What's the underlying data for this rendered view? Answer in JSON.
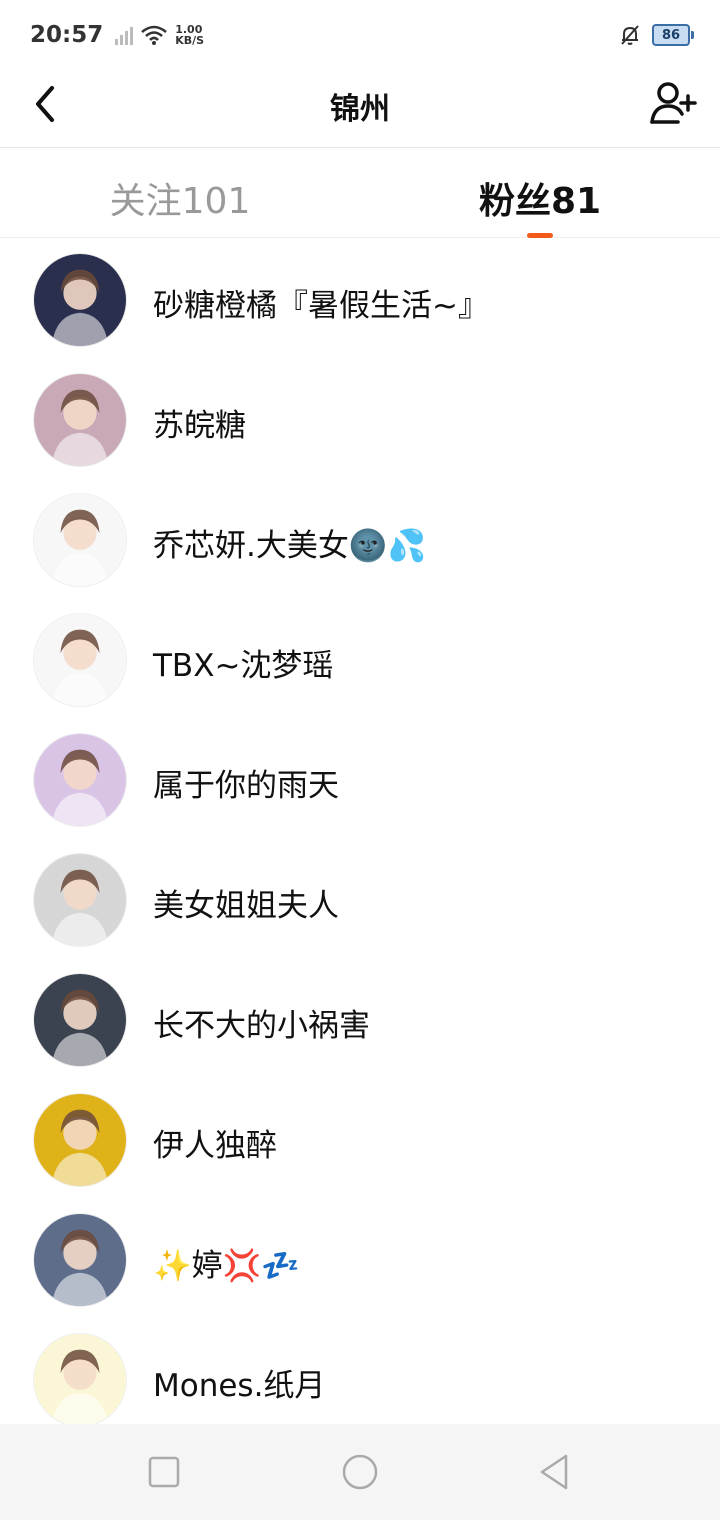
{
  "status": {
    "time": "20:57",
    "speed_value": "1.00",
    "speed_unit": "KB/S",
    "battery": "86"
  },
  "header": {
    "title": "锦州"
  },
  "tabs": {
    "following_label": "关注101",
    "followers_label": "粉丝81",
    "active": "followers",
    "accent_color": "#f25a1a"
  },
  "followers": [
    {
      "name": "砂糖橙橘『暑假生活~』",
      "avatar_icon": "anime-girl-avatar-icon",
      "avatar_color": "#2a2f4d"
    },
    {
      "name": "苏皖糖",
      "avatar_icon": "anime-girl-avatar-icon",
      "avatar_color": "#c9a9b8"
    },
    {
      "name": "乔芯妍.大美女🌚💦",
      "avatar_icon": "anime-figure-avatar-icon",
      "avatar_color": "#f7f7f7"
    },
    {
      "name": "TBX~沈梦瑶",
      "avatar_icon": "anime-figure-avatar-icon",
      "avatar_color": "#f7f7f7"
    },
    {
      "name": "属于你的雨天",
      "avatar_icon": "anime-boy-avatar-icon",
      "avatar_color": "#d9c4e6"
    },
    {
      "name": "美女姐姐夫人",
      "avatar_icon": "anime-girl-avatar-icon",
      "avatar_color": "#d6d6d6"
    },
    {
      "name": "长不大的小祸害",
      "avatar_icon": "portrait-avatar-icon",
      "avatar_color": "#3b4250"
    },
    {
      "name": "伊人独醉",
      "avatar_icon": "anime-girl-avatar-icon",
      "avatar_color": "#e0b21a"
    },
    {
      "name": "✨婷💢💤",
      "avatar_icon": "anime-girl-avatar-icon",
      "avatar_color": "#5e6d8a"
    },
    {
      "name": "Mones.纸月",
      "avatar_icon": "anime-figure-avatar-icon",
      "avatar_color": "#fbf7d6"
    }
  ],
  "nav": {
    "recents_icon": "square-icon",
    "home_icon": "circle-icon",
    "back_icon": "triangle-back-icon"
  }
}
